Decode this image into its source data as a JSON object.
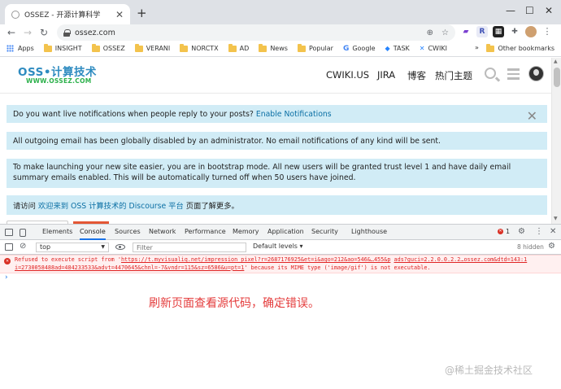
{
  "browser": {
    "tab_title": "OSSEZ - 开源计算科学",
    "tab_close": "✕",
    "new_tab": "+",
    "win_min": "—",
    "win_max": "☐",
    "win_close": "✕",
    "url": "ossez.com",
    "bookmarks": [
      {
        "label": "Apps",
        "icon": "apps-grid-icon"
      },
      {
        "label": "INSIGHT",
        "icon": "folder-icon"
      },
      {
        "label": "OSSEZ",
        "icon": "folder-icon"
      },
      {
        "label": "VERANI",
        "icon": "folder-icon"
      },
      {
        "label": "NORCTX",
        "icon": "folder-icon"
      },
      {
        "label": "AD",
        "icon": "folder-icon"
      },
      {
        "label": "News",
        "icon": "folder-icon"
      },
      {
        "label": "Popular",
        "icon": "folder-icon"
      },
      {
        "label": "Google",
        "icon": "google-icon"
      },
      {
        "label": "TASK",
        "icon": "jira-icon"
      },
      {
        "label": "CWIKI",
        "icon": "confluence-icon"
      }
    ],
    "bookmarks_overflow": "»",
    "other_bookmarks": "Other bookmarks"
  },
  "site": {
    "logo_main": "OSS•计算技术",
    "logo_sub": "WWW.OSSEZ.COM",
    "nav": [
      "CWIKI.US",
      "JIRA",
      "博客",
      "热门主题"
    ],
    "notices": {
      "n1_text": "Do you want live notifications when people reply to your posts?",
      "n1_link": "Enable Notifications",
      "n1_close": "✕",
      "n2_text": "All outgoing email has been globally disabled by an administrator. No email notifications of any kind will be sent.",
      "n3_text": "To make launching your new site easier, you are in bootstrap mode. All new users will be granted trust level 1 and have daily email summary emails enabled. This will be automatically turned off when 50 users have joined.",
      "n4_prefix": "请访问",
      "n4_link": "欢迎来到 OSS 计算技术的 Discourse 平台",
      "n4_suffix": "页面了解更多。"
    }
  },
  "devtools": {
    "tabs": [
      "Elements",
      "Console",
      "Sources",
      "Network",
      "Performance",
      "Memory",
      "Application",
      "Security",
      "Lighthouse"
    ],
    "active_tab": "Console",
    "error_count": "1",
    "context": "top",
    "filter_placeholder": "Filter",
    "levels": "Default levels ▾",
    "hidden": "8 hidden",
    "error": {
      "prefix": "Refused to execute script from '",
      "link1": "https://t.myvisualiq.net/impression_pixel?r=2687176925&et=i&ago=212&ao=546&…455&p",
      "link2": "ads?guci=2.2.0.0.2.2…ossez.com&dtd=143:1",
      "link3": "i=2730058488ad=484233533&advt=4470645&chnl=-7&vndr=115&sz=6586&u=pt=1",
      "suffix": "' because its MIME type ('image/gif') is not executable."
    },
    "prompt": "›"
  },
  "annotation": "刷新页面查看源代码，确定错误。",
  "watermark": "@稀土掘金技术社区",
  "colors": {
    "notice_bg": "#d1ecf6",
    "link": "#0b6fa4",
    "logo_blue": "#2e8bc0",
    "logo_green": "#2bb04a",
    "error_red": "#e02424",
    "annotation_red": "#e43c3c"
  }
}
